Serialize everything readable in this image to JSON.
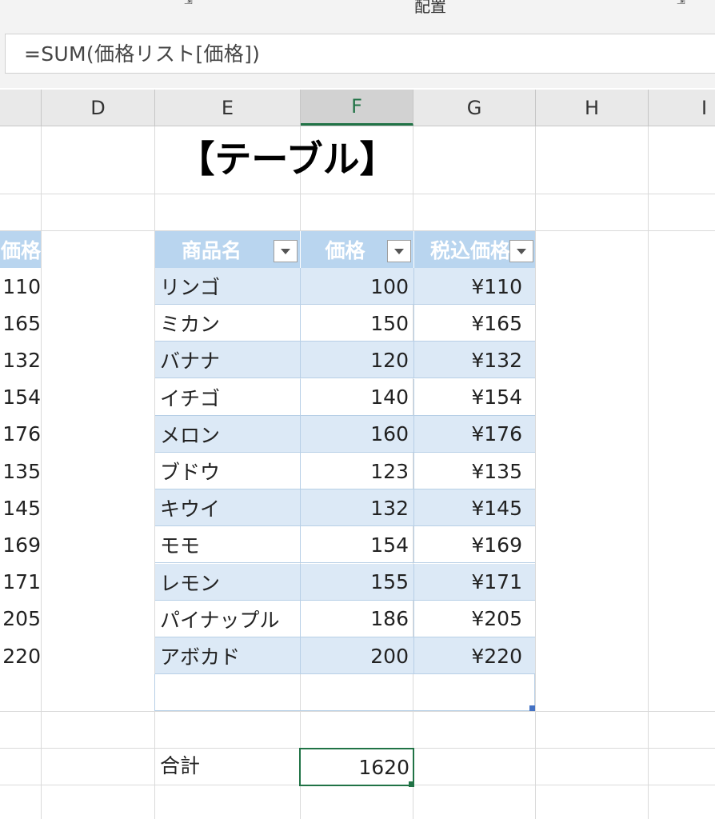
{
  "ribbon": {
    "group_label": "配置"
  },
  "formula_bar": {
    "formula": "=SUM(価格リスト[価格])"
  },
  "columns": [
    "D",
    "E",
    "F",
    "G",
    "H",
    "I"
  ],
  "sheet": {
    "title": "【テーブル】",
    "table": {
      "headers": [
        "商品名",
        "価格",
        "税込価格"
      ],
      "rows": [
        {
          "name": "リンゴ",
          "price": "100",
          "tax": "¥110"
        },
        {
          "name": "ミカン",
          "price": "150",
          "tax": "¥165"
        },
        {
          "name": "バナナ",
          "price": "120",
          "tax": "¥132"
        },
        {
          "name": "イチゴ",
          "price": "140",
          "tax": "¥154"
        },
        {
          "name": "メロン",
          "price": "160",
          "tax": "¥176"
        },
        {
          "name": "ブドウ",
          "price": "123",
          "tax": "¥135"
        },
        {
          "name": "キウイ",
          "price": "132",
          "tax": "¥145"
        },
        {
          "name": "モモ",
          "price": "154",
          "tax": "¥169"
        },
        {
          "name": "レモン",
          "price": "155",
          "tax": "¥171"
        },
        {
          "name": "パイナップル",
          "price": "186",
          "tax": "¥205"
        },
        {
          "name": "アボカド",
          "price": "200",
          "tax": "¥220"
        }
      ]
    },
    "left_partial": {
      "header": "価格",
      "values": [
        "110",
        "165",
        "132",
        "154",
        "176",
        "135",
        "145",
        "169",
        "171",
        "205",
        "220"
      ]
    },
    "total": {
      "label": "合計",
      "value": "1620"
    }
  },
  "colors": {
    "accent": "#217346",
    "table_header": "#b9d5ef",
    "table_band": "#dce9f6"
  }
}
